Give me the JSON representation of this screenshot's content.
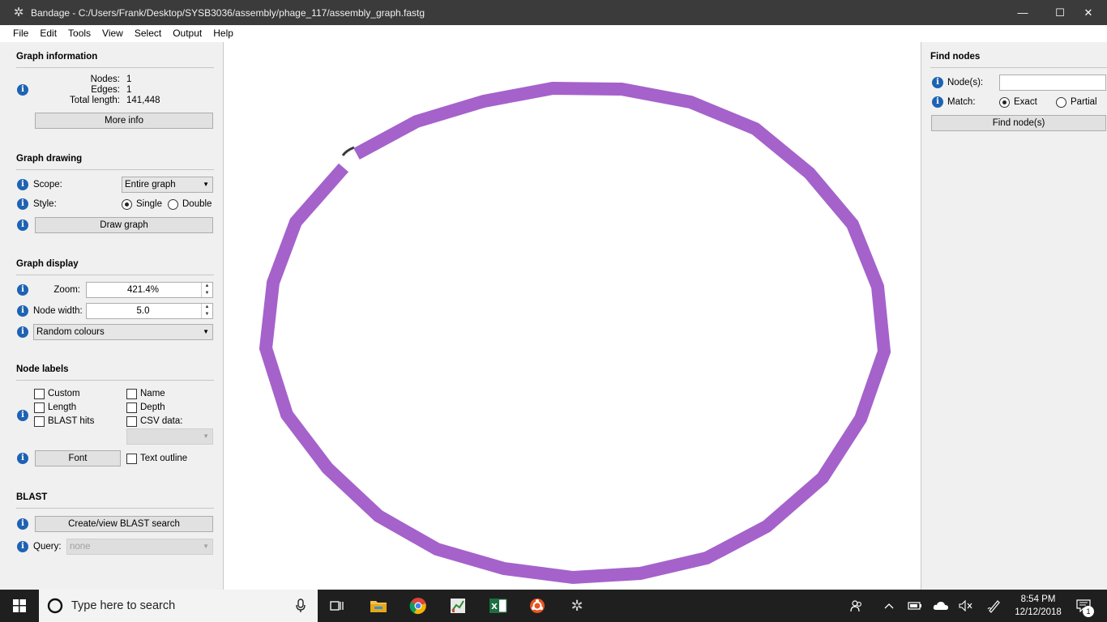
{
  "window": {
    "app_icon": "bandage-icon",
    "title": "Bandage - C:/Users/Frank/Desktop/SYSB3036/assembly/phage_117/assembly_graph.fastg",
    "minimize": "—",
    "maximize": "☐",
    "close": "✕"
  },
  "menu": [
    "File",
    "Edit",
    "Tools",
    "View",
    "Select",
    "Output",
    "Help"
  ],
  "graph_information": {
    "title": "Graph information",
    "nodes_label": "Nodes:",
    "nodes_value": "1",
    "edges_label": "Edges:",
    "edges_value": "1",
    "total_length_label": "Total length:",
    "total_length_value": "141,448",
    "more_info_button": "More info"
  },
  "graph_drawing": {
    "title": "Graph drawing",
    "scope_label": "Scope:",
    "scope_value": "Entire graph",
    "style_label": "Style:",
    "style_single": "Single",
    "style_double": "Double",
    "style_selected": "Single",
    "draw_button": "Draw graph"
  },
  "graph_display": {
    "title": "Graph display",
    "zoom_label": "Zoom:",
    "zoom_value": "421.4%",
    "node_width_label": "Node width:",
    "node_width_value": "5.0",
    "colour_scheme": "Random colours"
  },
  "node_labels": {
    "title": "Node labels",
    "custom": "Custom",
    "length": "Length",
    "blast_hits": "BLAST hits",
    "name": "Name",
    "depth": "Depth",
    "csv_data": "CSV data:",
    "font_button": "Font",
    "text_outline": "Text outline"
  },
  "blast": {
    "title": "BLAST",
    "create_button": "Create/view BLAST search",
    "query_label": "Query:",
    "query_value": "none"
  },
  "find_nodes": {
    "title": "Find nodes",
    "nodes_label": "Node(s):",
    "nodes_value": "",
    "match_label": "Match:",
    "exact": "Exact",
    "partial": "Partial",
    "match_selected": "Exact",
    "find_button": "Find node(s)"
  },
  "graph": {
    "node_color": "#a562cb",
    "edge_color": "#3a3a3a"
  },
  "taskbar": {
    "search_placeholder": "Type here to search",
    "time": "8:54 PM",
    "date": "12/12/2018",
    "notification_count": "1",
    "pinned_apps": [
      "task-view-icon",
      "file-explorer-icon",
      "chrome-icon",
      "chart-app-icon",
      "excel-icon",
      "ubuntu-icon",
      "bandage-icon"
    ]
  }
}
